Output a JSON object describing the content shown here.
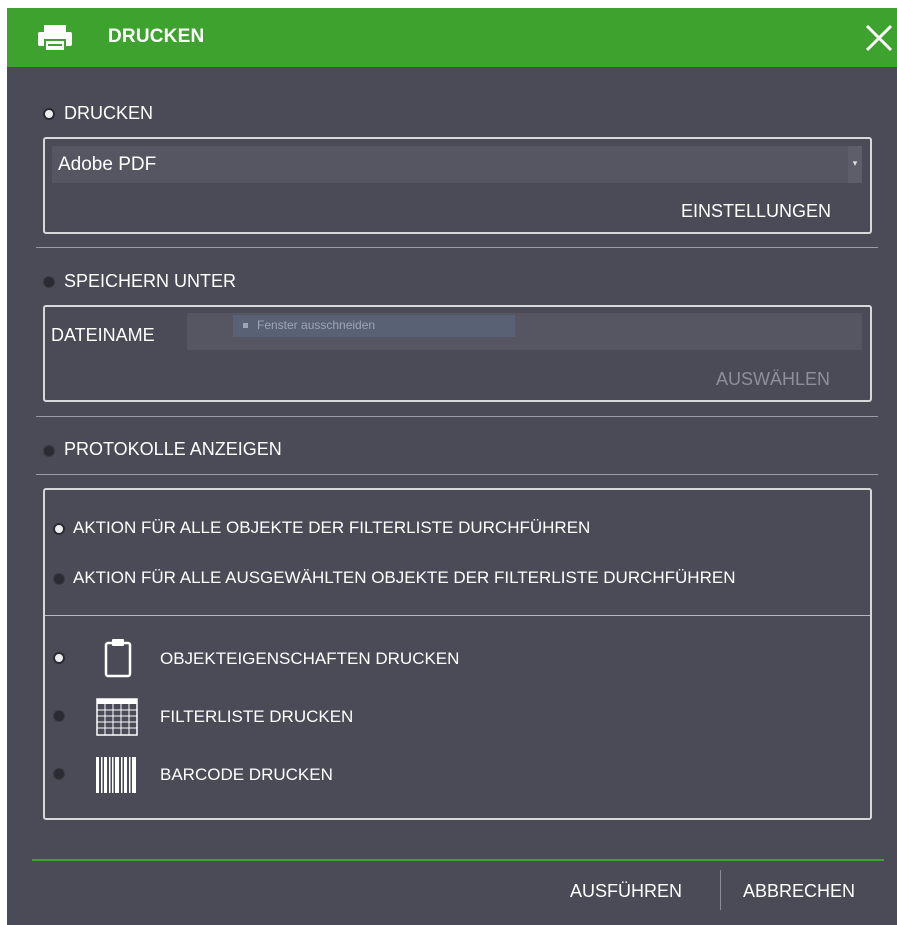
{
  "dialog": {
    "title": "DRUCKEN",
    "title_icon": "printer-icon",
    "close_icon": "close-icon",
    "accent_color": "#3ea22e",
    "background_color": "#4a4b57"
  },
  "print_section": {
    "label": "DRUCKEN",
    "selected": true,
    "printer_value": "Adobe PDF",
    "settings_label": "EINSTELLUNGEN"
  },
  "save_section": {
    "label": "SPEICHERN UNTER",
    "selected": false,
    "filename_label": "DATEINAME",
    "filename_value": "",
    "overlay_text": "Fenster ausschneiden",
    "select_label": "AUSWÄHLEN"
  },
  "logs_section": {
    "label": "PROTOKOLLE ANZEIGEN",
    "selected": false
  },
  "scope_options": [
    {
      "label": "AKTION FÜR ALLE OBJEKTE DER FILTERLISTE DURCHFÜHREN",
      "selected": true
    },
    {
      "label": "AKTION FÜR ALLE AUSGEWÄHLTEN OBJEKTE DER FILTERLISTE DURCHFÜHREN",
      "selected": false
    }
  ],
  "print_options": [
    {
      "label": "OBJEKTEIGENSCHAFTEN DRUCKEN",
      "icon": "clipboard-icon",
      "selected": true
    },
    {
      "label": "FILTERLISTE DRUCKEN",
      "icon": "table-grid-icon",
      "selected": false
    },
    {
      "label": "BARCODE DRUCKEN",
      "icon": "barcode-icon",
      "selected": false
    }
  ],
  "footer": {
    "execute_label": "AUSFÜHREN",
    "cancel_label": "ABBRECHEN"
  }
}
